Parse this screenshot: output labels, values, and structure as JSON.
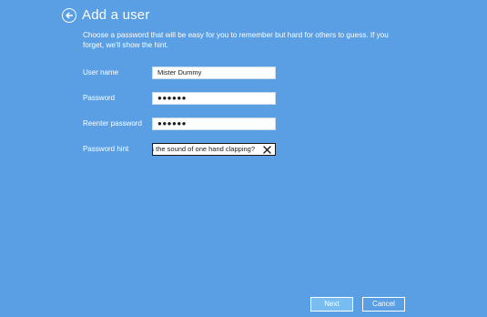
{
  "header": {
    "title": "Add a user",
    "back_icon": "back-arrow-icon"
  },
  "instructions": "Choose a password that will be easy for you to remember but hard for others to guess. If you forget, we'll show the hint.",
  "form": {
    "username": {
      "label": "User name",
      "value": "Mister Dummy"
    },
    "password": {
      "label": "Password",
      "value": "●●●●●●"
    },
    "reenter_password": {
      "label": "Reenter password",
      "value": "●●●●●●"
    },
    "password_hint": {
      "label": "Password hint",
      "value": "What is the sound of one hand clapping?",
      "clear_icon": "close-icon"
    }
  },
  "buttons": {
    "next": "Next",
    "cancel": "Cancel"
  },
  "colors": {
    "background": "#5a9ee3",
    "next_button": "#79bdf0",
    "text": "#ffffff"
  }
}
